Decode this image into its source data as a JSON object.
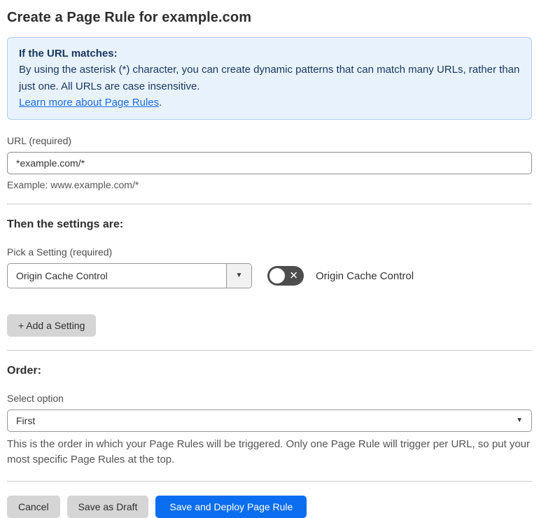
{
  "page": {
    "title": "Create a Page Rule for example.com"
  },
  "info_box": {
    "heading": "If the URL matches:",
    "body": "By using the asterisk (*) character, you can create dynamic patterns that can match many URLs, rather than just one. All URLs are case insensitive.",
    "link": "Learn more about Page Rules",
    "link_suffix": "."
  },
  "url_section": {
    "label": "URL (required)",
    "input_value": "*example.com/*",
    "hint": "Example: www.example.com/*"
  },
  "settings_section": {
    "heading": "Then the settings are:",
    "picker_label": "Pick a Setting (required)",
    "selected_setting": "Origin Cache Control",
    "toggle_state": "off",
    "toggle_label": "Origin Cache Control",
    "add_setting_button": "+ Add a Setting"
  },
  "order_section": {
    "heading": "Order:",
    "select_label": "Select option",
    "selected_option": "First",
    "help_text": "This is the order in which your Page Rules will be triggered. Only one Page Rule will trigger per URL, so put your most specific Page Rules at the top."
  },
  "footer": {
    "cancel_label": "Cancel",
    "save_draft_label": "Save as Draft",
    "save_deploy_label": "Save and Deploy Page Rule"
  },
  "icons": {
    "dropdown_caret": "▼",
    "toggle_x": "✕"
  },
  "colors": {
    "accent_blue": "#0b6ef0",
    "info_background": "#e8f2fd",
    "info_border": "#aecdee",
    "info_text": "#17365d",
    "link_blue": "#1b6ce0",
    "toggle_off_background": "#4d4d4d",
    "button_gray": "#d5d5d5"
  }
}
